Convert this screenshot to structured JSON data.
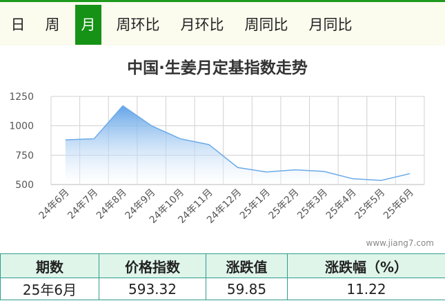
{
  "tabs": [
    {
      "label": "日",
      "active": false
    },
    {
      "label": "周",
      "active": false
    },
    {
      "label": "月",
      "active": true
    },
    {
      "label": "周环比",
      "active": false
    },
    {
      "label": "月环比",
      "active": false
    },
    {
      "label": "周同比",
      "active": false
    },
    {
      "label": "月同比",
      "active": false
    }
  ],
  "colors": {
    "accent": "#169216",
    "area_top": "#5a9fe6",
    "line": "#6aaae8",
    "table_border": "#2e9c8c",
    "table_header": "#dff5ea"
  },
  "chart_data": {
    "type": "area",
    "title": "中国·生姜月定基指数走势",
    "categories": [
      "24年6月",
      "24年7月",
      "24年8月",
      "24年9月",
      "24年10月",
      "24年11月",
      "24年12月",
      "25年1月",
      "25年2月",
      "25年3月",
      "25年4月",
      "25年5月",
      "25年6月"
    ],
    "series": [
      {
        "values": [
          880,
          890,
          1170,
          1000,
          890,
          840,
          645,
          607,
          625,
          612,
          550,
          535,
          593.32
        ]
      }
    ],
    "yticks": [
      500,
      750,
      1000,
      1250
    ],
    "ylim": [
      500,
      1250
    ],
    "grid": true
  },
  "watermark": "www.jiang7.com",
  "table": {
    "headers": [
      "期数",
      "价格指数",
      "涨跌值",
      "涨跌幅（%）"
    ],
    "rows": [
      [
        "25年6月",
        "593.32",
        "59.85",
        "11.22"
      ]
    ]
  }
}
